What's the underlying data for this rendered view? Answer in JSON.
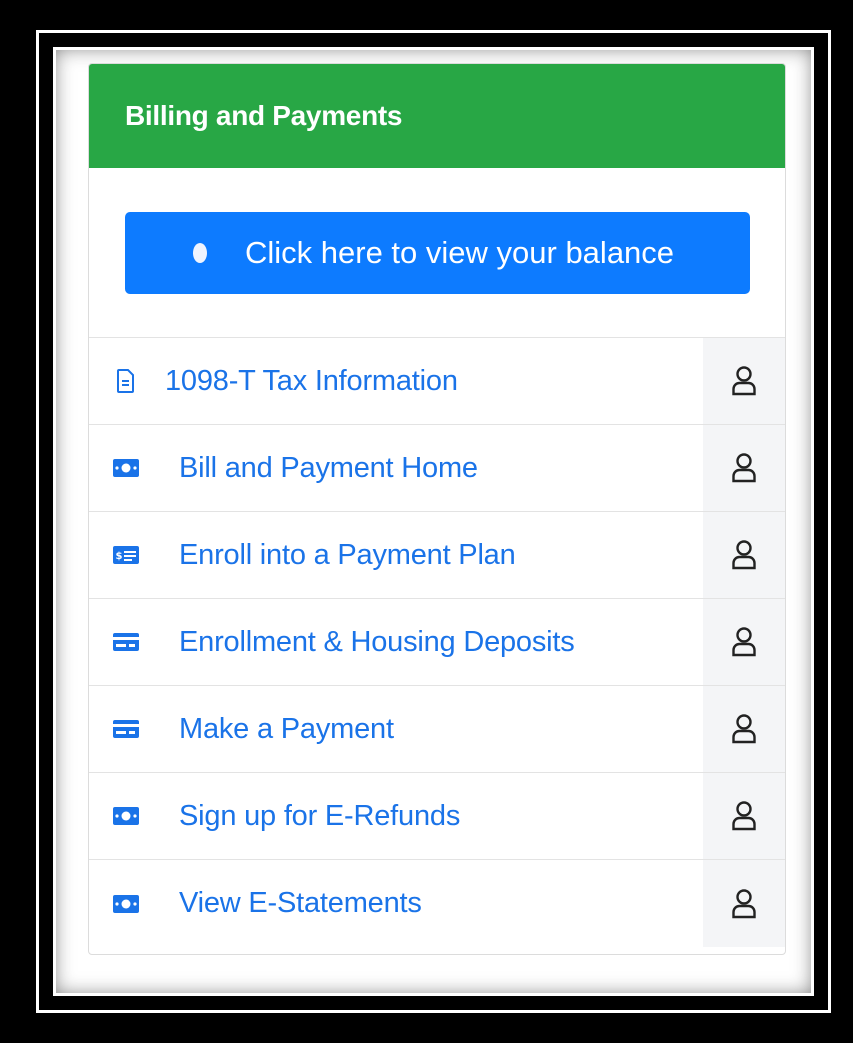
{
  "card": {
    "title": "Billing and Payments",
    "balance_button_label": "Click here to view your balance"
  },
  "items": [
    {
      "label": "1098-T Tax Information",
      "icon": "document-icon"
    },
    {
      "label": "Bill and Payment Home",
      "icon": "money-icon"
    },
    {
      "label": "Enroll into a Payment Plan",
      "icon": "payment-plan-icon"
    },
    {
      "label": "Enrollment & Housing Deposits",
      "icon": "credit-card-icon"
    },
    {
      "label": "Make a Payment",
      "icon": "credit-card-icon"
    },
    {
      "label": "Sign up for E-Refunds",
      "icon": "money-icon"
    },
    {
      "label": "View E-Statements",
      "icon": "money-icon"
    }
  ],
  "colors": {
    "header": "#28a745",
    "button": "#0d7bff",
    "link": "#1a73e8"
  }
}
